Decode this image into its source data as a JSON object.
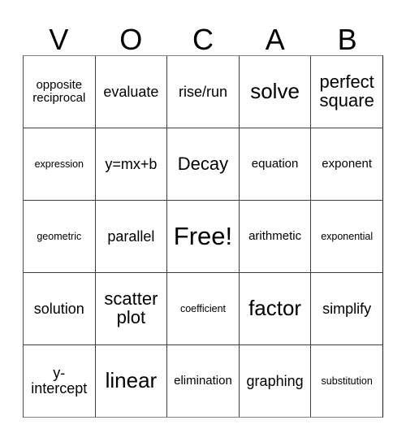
{
  "card": {
    "title_letters": [
      "V",
      "O",
      "C",
      "A",
      "B"
    ],
    "columns": 5,
    "rows": 5,
    "free_space": "Free!",
    "rows_data": [
      [
        {
          "text": "opposite reciprocal",
          "size": "fs-s"
        },
        {
          "text": "evaluate",
          "size": "fs-m"
        },
        {
          "text": "rise/run",
          "size": "fs-m"
        },
        {
          "text": "solve",
          "size": "fs-xl"
        },
        {
          "text": "perfect square",
          "size": "fs-l"
        }
      ],
      [
        {
          "text": "expression",
          "size": "fs-xs"
        },
        {
          "text": "y=mx+b",
          "size": "fs-m"
        },
        {
          "text": "Decay",
          "size": "fs-l"
        },
        {
          "text": "equation",
          "size": "fs-s"
        },
        {
          "text": "exponent",
          "size": "fs-s"
        }
      ],
      [
        {
          "text": "geometric",
          "size": "fs-xs"
        },
        {
          "text": "parallel",
          "size": "fs-m"
        },
        {
          "text": "Free!",
          "size": "fs-xxl"
        },
        {
          "text": "arithmetic",
          "size": "fs-s"
        },
        {
          "text": "exponential",
          "size": "fs-xs"
        }
      ],
      [
        {
          "text": "solution",
          "size": "fs-m"
        },
        {
          "text": "scatter plot",
          "size": "fs-l"
        },
        {
          "text": "coefficient",
          "size": "fs-xs"
        },
        {
          "text": "factor",
          "size": "fs-xl"
        },
        {
          "text": "simplify",
          "size": "fs-m"
        }
      ],
      [
        {
          "text": "y-intercept",
          "size": "fs-m"
        },
        {
          "text": "linear",
          "size": "fs-xl"
        },
        {
          "text": "elimination",
          "size": "fs-s"
        },
        {
          "text": "graphing",
          "size": "fs-m"
        },
        {
          "text": "substitution",
          "size": "fs-xs"
        }
      ]
    ]
  },
  "colors": {
    "background": "#ffffff",
    "text": "#000000",
    "grid_line": "#3c3c3c",
    "outer_border": "#808080"
  }
}
